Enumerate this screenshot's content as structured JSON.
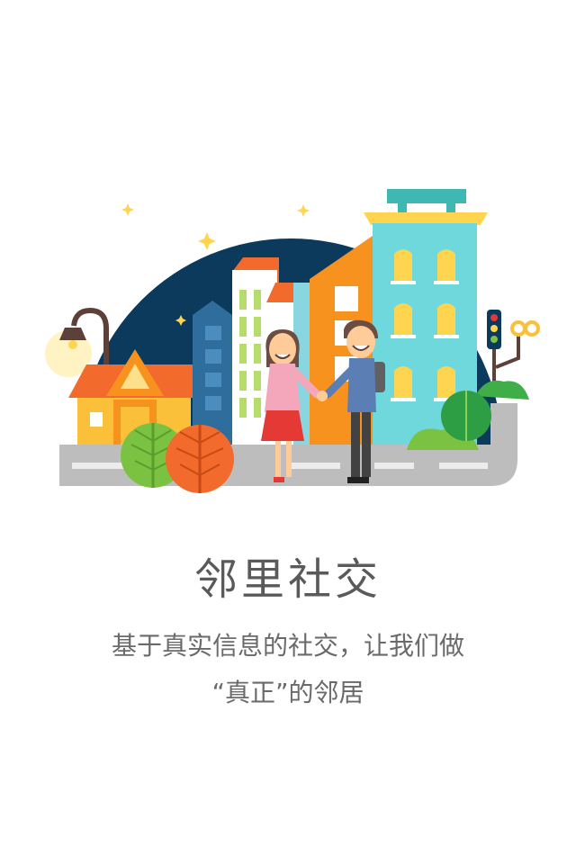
{
  "onboarding": {
    "title": "邻里社交",
    "description_line1": "基于真实信息的社交，让我们做",
    "description_line2": "“真正”的邻居"
  },
  "colors": {
    "night_sky": "#0b3a5c",
    "road": "#bdbdbd",
    "cyan_building": "#6fd8dc",
    "orange_building": "#f7921e",
    "green_tree": "#7cc242",
    "orange_tree": "#f26b2c"
  },
  "icons": [
    "star-icon",
    "street-lamp-icon",
    "traffic-light-icon",
    "tree-icon"
  ]
}
